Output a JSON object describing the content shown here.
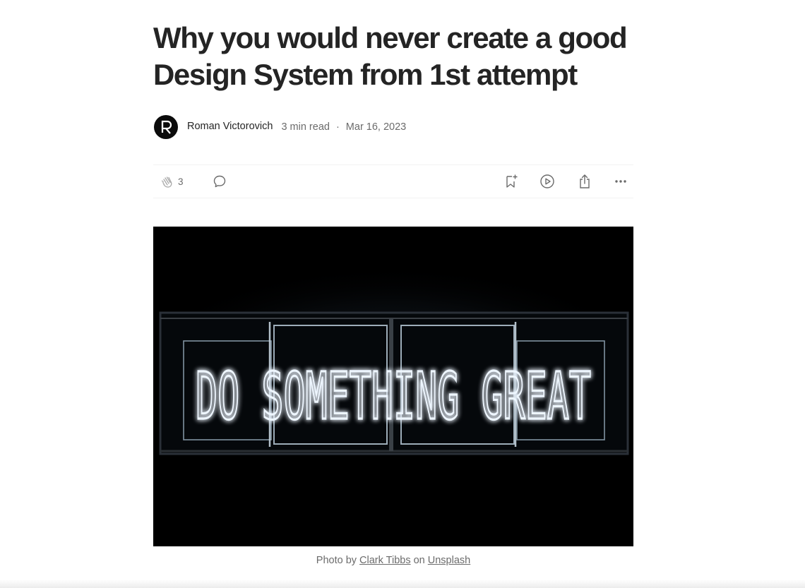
{
  "article": {
    "title_line1": "Why you would never create a good",
    "title_line2": "Design System from 1st attempt",
    "author": "Roman Victorovich",
    "read_time": "3 min read",
    "separator": "·",
    "date": "Mar 16, 2023"
  },
  "actions": {
    "clap_count": "3",
    "icons": [
      "clap-icon",
      "comment-icon",
      "bookmark-add-icon",
      "play-icon",
      "share-icon",
      "more-icon"
    ]
  },
  "hero": {
    "neon_text": "DO SOMETHING GREAT",
    "caption_prefix": "Photo by ",
    "caption_author": "Clark Tibbs",
    "caption_middle": " on ",
    "caption_source": "Unsplash"
  },
  "colors": {
    "text_primary": "#242424",
    "text_secondary": "#6b6b6b",
    "divider": "#f2f2f2",
    "neon": "#eef6ff"
  }
}
